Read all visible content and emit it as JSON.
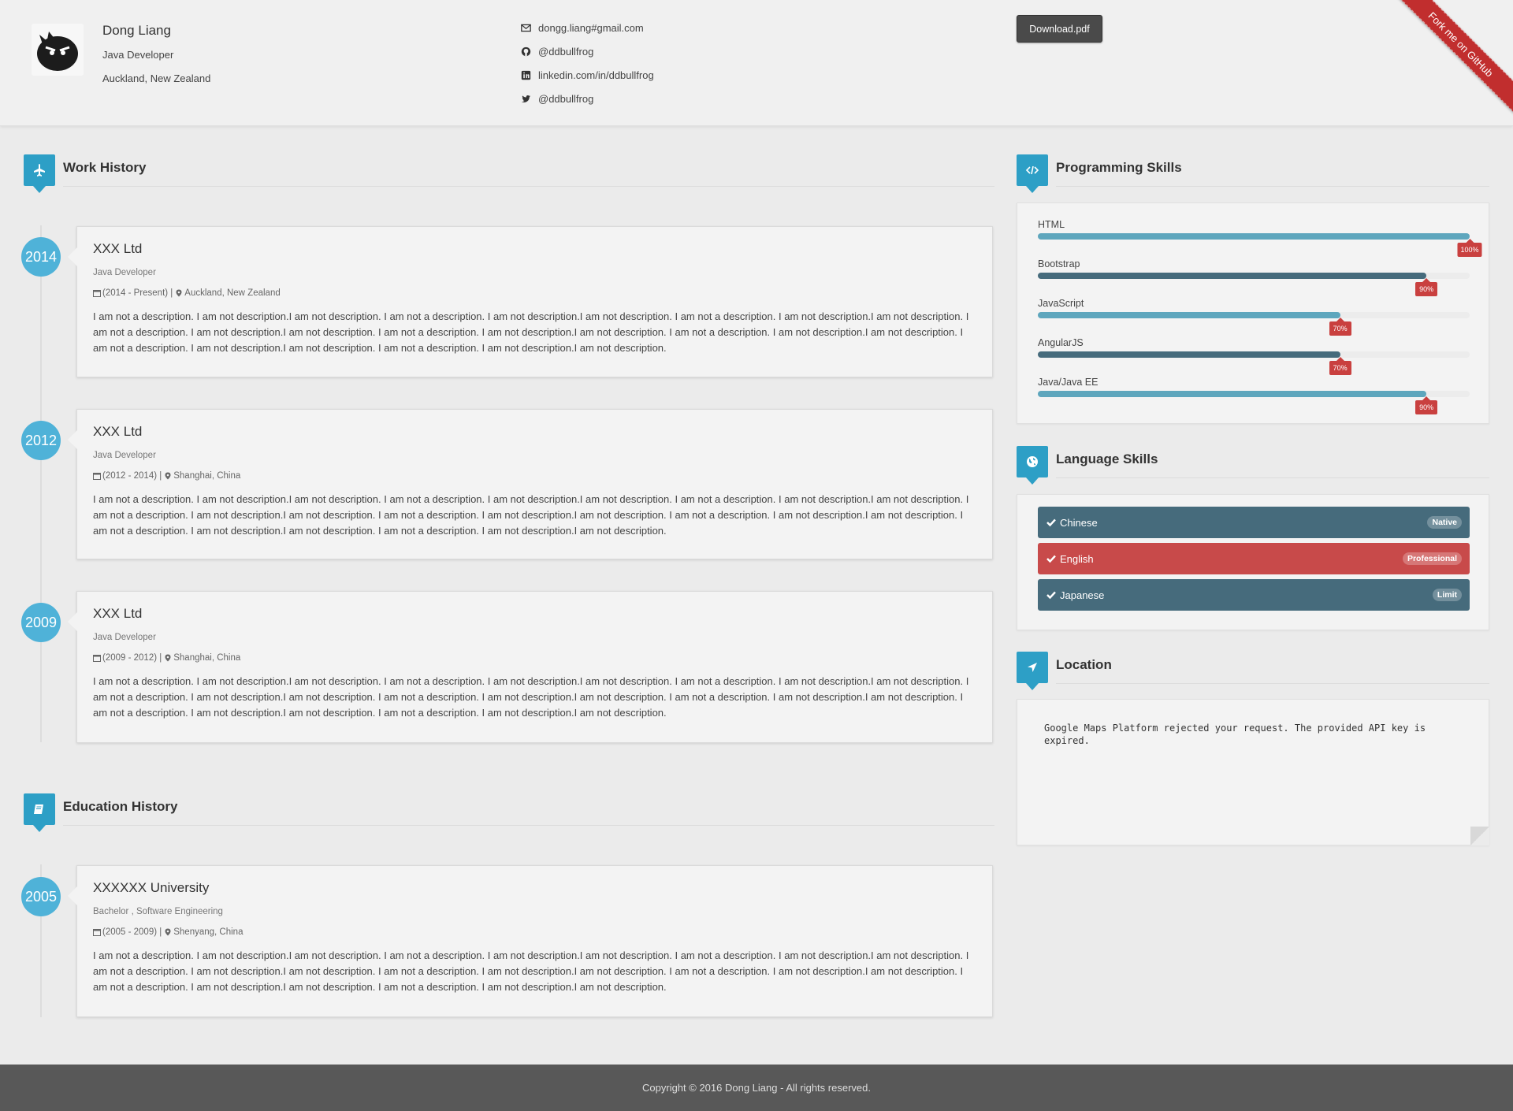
{
  "profile": {
    "name": "Dong Liang",
    "role": "Java Developer",
    "location": "Auckland, New Zealand"
  },
  "contacts": [
    {
      "icon": "envelope-icon",
      "text": "dongg.liang#gmail.com"
    },
    {
      "icon": "github-icon",
      "text": "@ddbullfrog"
    },
    {
      "icon": "linkedin-icon",
      "text": "linkedin.com/in/ddbullfrog"
    },
    {
      "icon": "twitter-icon",
      "text": "@ddbullfrog"
    }
  ],
  "header": {
    "download_label": "Download.pdf",
    "ribbon_label": "Fork me on GitHub"
  },
  "work": {
    "title": "Work History",
    "items": [
      {
        "year": "2014",
        "company": "XXX Ltd",
        "role": "Java Developer",
        "period": "(2014 - Present) |",
        "place": "Auckland, New Zealand",
        "desc": "I am not a description. I am not description.I am not description. I am not a description. I am not description.I am not description. I am not a description. I am not description.I am not description. I am not a description. I am not description.I am not description. I am not a description. I am not description.I am not description. I am not a description. I am not description.I am not description. I am not a description. I am not description.I am not description. I am not a description. I am not description.I am not description."
      },
      {
        "year": "2012",
        "company": "XXX Ltd",
        "role": "Java Developer",
        "period": "(2012 - 2014) |",
        "place": "Shanghai, China",
        "desc": "I am not a description. I am not description.I am not description. I am not a description. I am not description.I am not description. I am not a description. I am not description.I am not description. I am not a description. I am not description.I am not description. I am not a description. I am not description.I am not description. I am not a description. I am not description.I am not description. I am not a description. I am not description.I am not description. I am not a description. I am not description.I am not description."
      },
      {
        "year": "2009",
        "company": "XXX Ltd",
        "role": "Java Developer",
        "period": "(2009 - 2012) |",
        "place": "Shanghai, China",
        "desc": "I am not a description. I am not description.I am not description. I am not a description. I am not description.I am not description. I am not a description. I am not description.I am not description. I am not a description. I am not description.I am not description. I am not a description. I am not description.I am not description. I am not a description. I am not description.I am not description. I am not a description. I am not description.I am not description. I am not a description. I am not description.I am not description."
      }
    ]
  },
  "education": {
    "title": "Education History",
    "items": [
      {
        "year": "2005",
        "school": "XXXXXX University",
        "degree": "Bachelor , Software Engineering",
        "period": "(2005 - 2009) |",
        "place": "Shenyang, China",
        "desc": "I am not a description. I am not description.I am not description. I am not a description. I am not description.I am not description. I am not a description. I am not description.I am not description. I am not a description. I am not description.I am not description. I am not a description. I am not description.I am not description. I am not a description. I am not description.I am not description. I am not a description. I am not description.I am not description. I am not a description. I am not description.I am not description."
      }
    ]
  },
  "programming": {
    "title": "Programming Skills",
    "items": [
      {
        "name": "HTML",
        "label": "100%",
        "level": 1.0,
        "color": "#5ea6bd"
      },
      {
        "name": "Bootstrap",
        "label": "90%",
        "level": 0.9,
        "color": "#466b7c"
      },
      {
        "name": "JavaScript",
        "label": "70%",
        "level": 0.7,
        "color": "#5ea6bd"
      },
      {
        "name": "AngularJS",
        "label": "70%",
        "level": 0.7,
        "color": "#466b7c"
      },
      {
        "name": "Java/Java EE",
        "label": "90%",
        "level": 0.9,
        "color": "#5ea6bd"
      }
    ]
  },
  "languages": {
    "title": "Language Skills",
    "items": [
      {
        "name": "Chinese",
        "level": "Native",
        "color": "#466b7c"
      },
      {
        "name": "English",
        "level": "Professional",
        "color": "#c84a4a"
      },
      {
        "name": "Japanese",
        "level": "Limit",
        "color": "#466b7c"
      }
    ]
  },
  "location": {
    "title": "Location",
    "message": "Google Maps Platform rejected your request. The provided API key is expired."
  },
  "footer": {
    "text": "Copyright © 2016 Dong Liang - All rights reserved."
  },
  "colors": {
    "accent": "#2d9fc6",
    "year_circle": "#4fb2d8",
    "badge_red": "#c9403f",
    "footer_bg": "#585858"
  }
}
